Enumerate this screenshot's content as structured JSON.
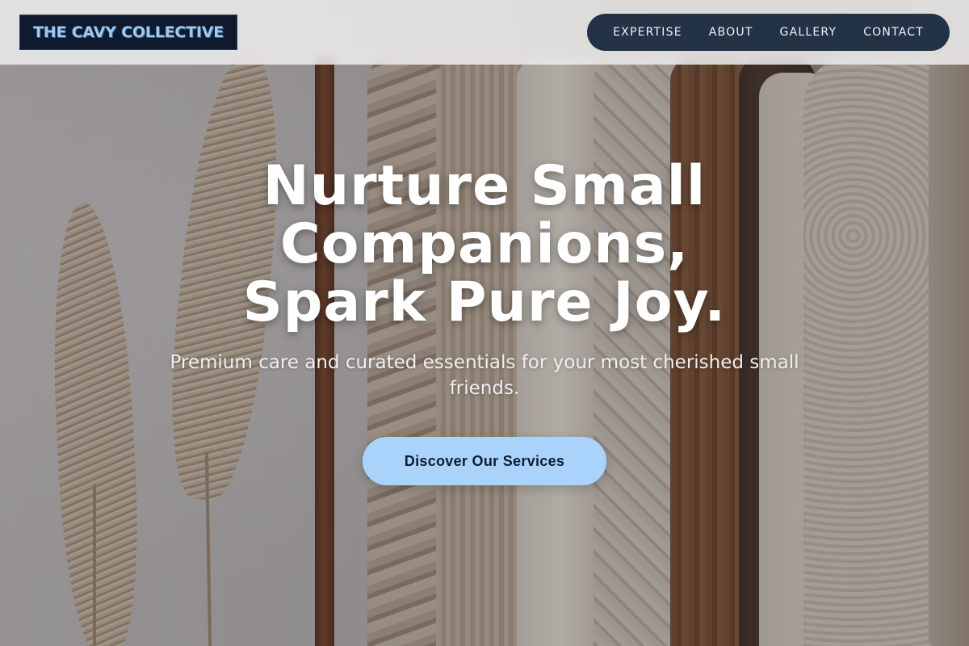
{
  "brand": {
    "name": "THE CAVY COLLECTIVE",
    "text_color": "#9cc8f2",
    "bg_color": "#0f1a2e"
  },
  "nav": {
    "items": [
      {
        "label": "EXPERTISE"
      },
      {
        "label": "ABOUT"
      },
      {
        "label": "GALLERY"
      },
      {
        "label": "CONTACT"
      }
    ],
    "bg_color": "#243246"
  },
  "hero": {
    "title_line1": "Nurture Small",
    "title_line2": "Companions,",
    "title_line3": "Spark Pure Joy.",
    "subtitle": "Premium care and curated essentials for your most cherished small friends.",
    "cta_label": "Discover Our Services",
    "cta_color": "#a9d3fb"
  }
}
